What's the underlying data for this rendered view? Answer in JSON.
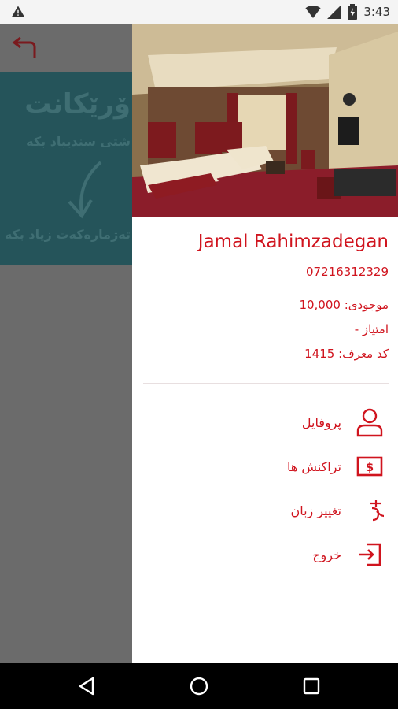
{
  "status_bar": {
    "time": "3:43",
    "icons": [
      "warning-icon",
      "wifi-icon",
      "signal-icon",
      "battery-icon"
    ]
  },
  "background_app": {
    "banner_title": "ۆرێکانت",
    "banner_subtitle": "شتی سندیباد بکە",
    "banner_cta": "تەژمارەکەت زیاد بکە",
    "accent": "#25545a"
  },
  "drawer": {
    "user_name": "Jamal Rahimzadegan",
    "phone": "07216312329",
    "balance_line": "موجودی: 10,000",
    "points_line": "امتیاز -",
    "referral_line": "کد معرف: 1415",
    "menu": [
      {
        "label": "پروفایل",
        "icon": "user-icon"
      },
      {
        "label": "تراکنش ها",
        "icon": "dollar-note-icon"
      },
      {
        "label": "تغییر زبان",
        "icon": "translate-icon"
      },
      {
        "label": "خروج",
        "icon": "logout-icon"
      }
    ],
    "accent": "#d0141e"
  },
  "nav_bar": {
    "buttons": [
      "back-icon",
      "home-icon",
      "recents-icon"
    ]
  }
}
